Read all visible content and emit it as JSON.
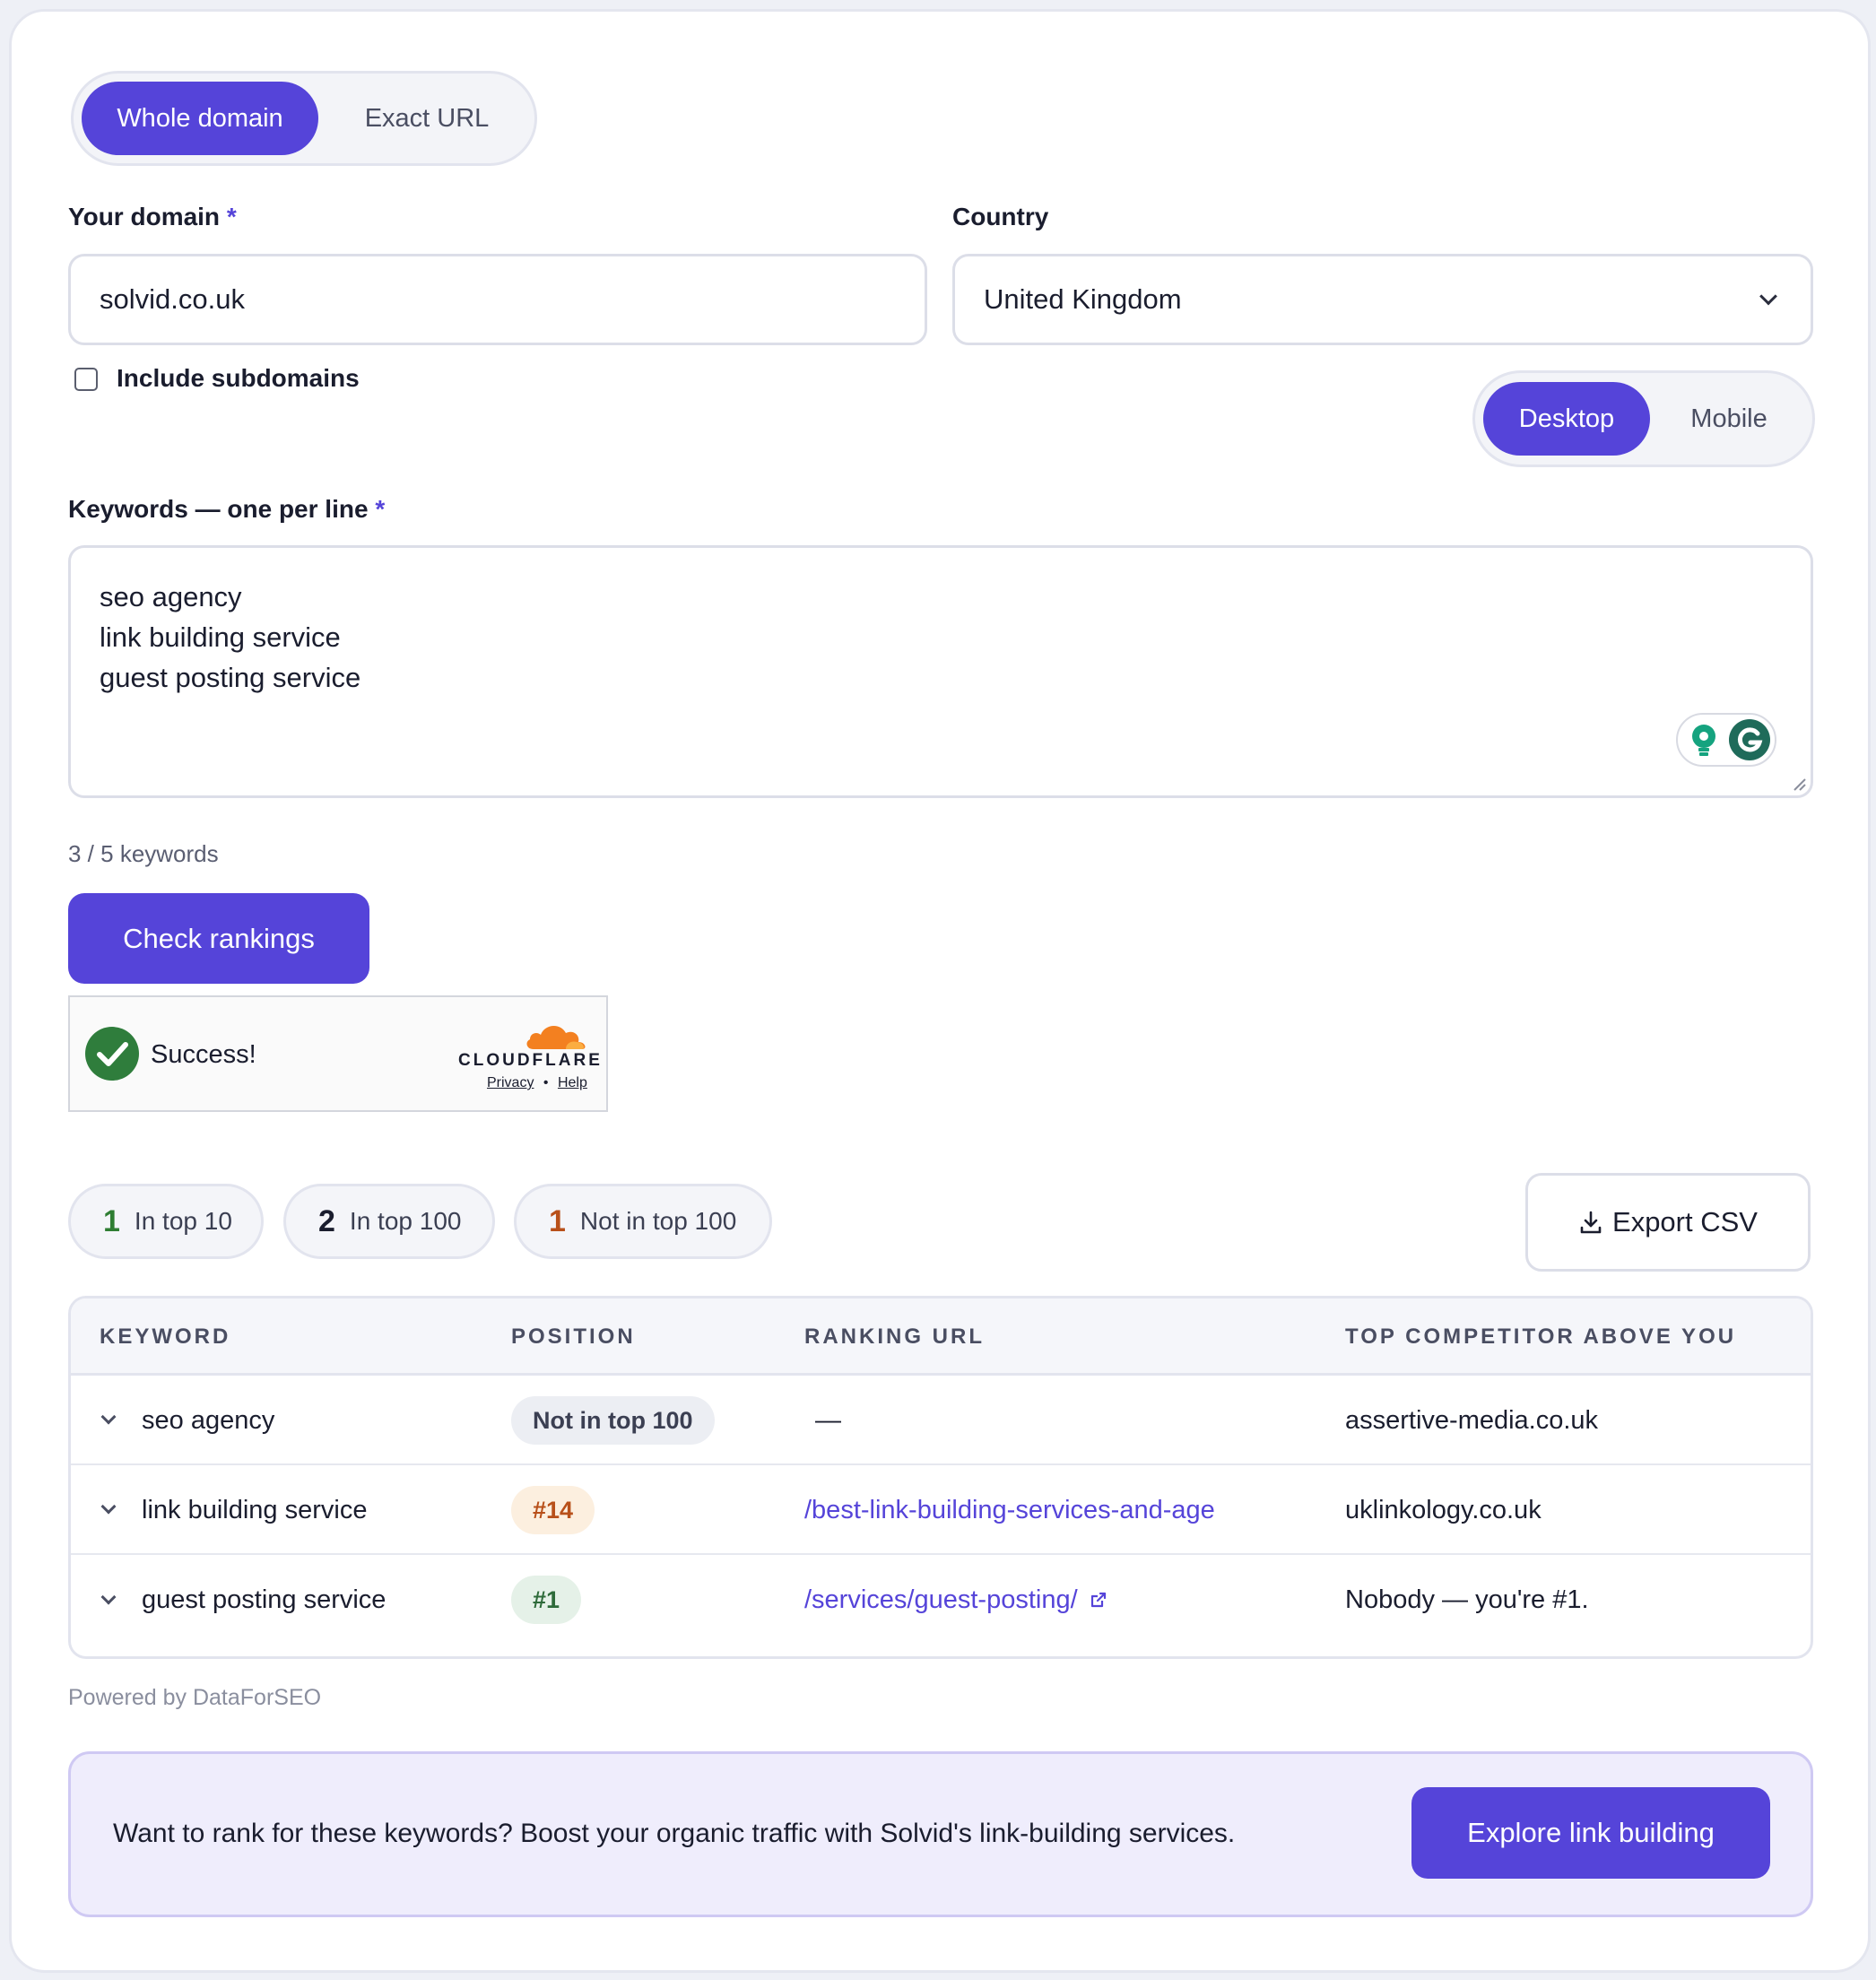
{
  "mode_toggle": {
    "whole_domain": "Whole domain",
    "exact_url": "Exact URL",
    "selected": "Whole domain"
  },
  "domain": {
    "label": "Your domain",
    "required_mark": "*",
    "value": "solvid.co.uk"
  },
  "country": {
    "label": "Country",
    "value": "United Kingdom"
  },
  "subdomains": {
    "label": "Include subdomains",
    "checked": false
  },
  "device_toggle": {
    "desktop": "Desktop",
    "mobile": "Mobile",
    "selected": "Desktop"
  },
  "keywords": {
    "label": "Keywords — one per line",
    "required_mark": "*",
    "lines": [
      "seo agency",
      "link building service",
      "guest posting service"
    ],
    "count_text": "3 / 5 keywords"
  },
  "check_button": "Check rankings",
  "captcha": {
    "status": "Success!",
    "brand": "CLOUDFLARE",
    "privacy": "Privacy",
    "separator": "•",
    "help": "Help"
  },
  "summary": {
    "top10": {
      "count": "1",
      "label": "In top 10",
      "color": "#2e7d32"
    },
    "top100": {
      "count": "2",
      "label": "In top 100",
      "color": "#1a1d2e"
    },
    "not_top100": {
      "count": "1",
      "label": "Not in top 100",
      "color": "#b8501a"
    }
  },
  "export_button": "Export CSV",
  "table": {
    "headers": [
      "KEYWORD",
      "POSITION",
      "RANKING URL",
      "TOP COMPETITOR ABOVE YOU"
    ],
    "rows": [
      {
        "keyword": "seo agency",
        "position": "Not in top 100",
        "url": "—",
        "competitor": "assertive-media.co.uk"
      },
      {
        "keyword": "link building service",
        "position": "#14",
        "url": "/best-link-building-services-and-age",
        "competitor": "uklinkology.co.uk"
      },
      {
        "keyword": "guest posting service",
        "position": "#1",
        "url": "/services/guest-posting/",
        "competitor": "Nobody — you're #1."
      }
    ]
  },
  "powered_by": "Powered by DataForSEO",
  "promo": {
    "text": "Want to rank for these keywords? Boost your organic traffic with Solvid's link-building services.",
    "button": "Explore link building"
  },
  "colors": {
    "accent": "#5544d9",
    "success": "#2e7d32",
    "warning": "#b8501a"
  }
}
